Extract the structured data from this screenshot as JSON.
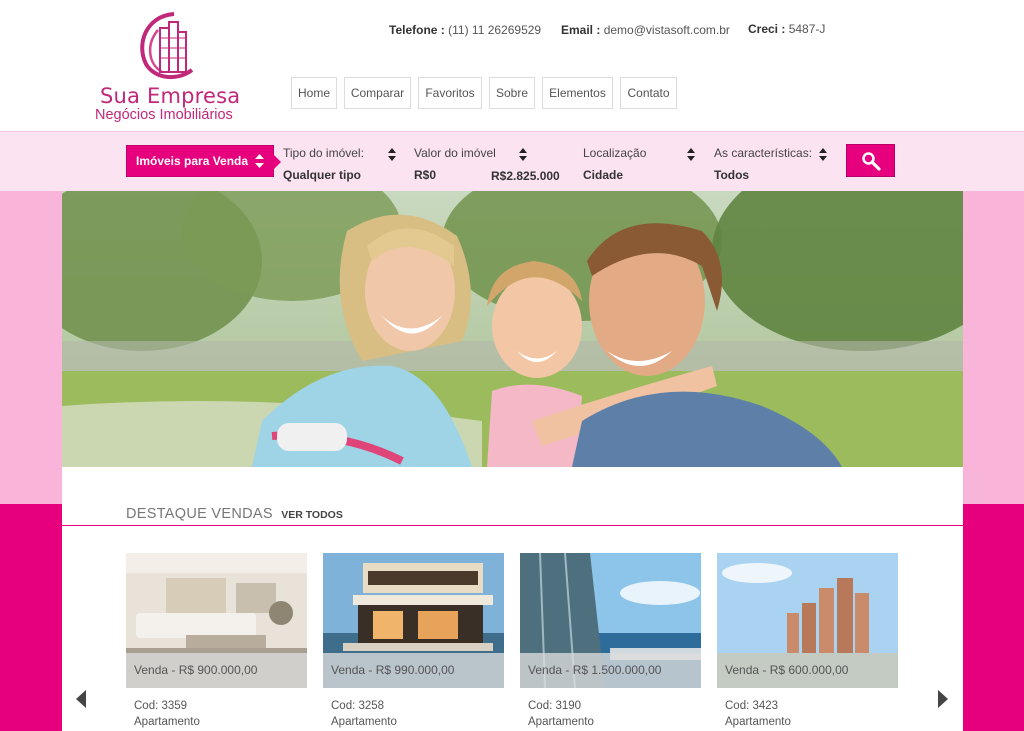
{
  "header": {
    "logo": {
      "name": "Sua Empresa",
      "tagline": "Negócios Imobiliários"
    },
    "contact": {
      "phone_label": "Telefone :",
      "phone": "(11) 11 26269529",
      "email_label": "Email :",
      "email": "demo@vistasoft.com.br",
      "creci_label": "Creci :",
      "creci": "5487-J"
    },
    "nav": [
      "Home",
      "Comparar",
      "Favoritos",
      "Sobre",
      "Elementos",
      "Contato"
    ]
  },
  "search": {
    "listing_type": "Imóveis para Venda",
    "property_type": {
      "label": "Tipo do imóvel:",
      "value": "Qualquer tipo"
    },
    "price": {
      "label": "Valor do imóvel",
      "min": "R$0",
      "max": "R$2.825.000"
    },
    "location": {
      "label": "Localização",
      "value": "Cidade"
    },
    "features": {
      "label": "As características:",
      "value": "Todos"
    }
  },
  "featured": {
    "title": "DESTAQUE VENDAS",
    "see_all": "VER TODOS",
    "cards": [
      {
        "price": "Venda - R$ 900.000,00",
        "code": "Cod: 3359",
        "kind": "Apartamento"
      },
      {
        "price": "Venda - R$ 990.000,00",
        "code": "Cod: 3258",
        "kind": "Apartamento"
      },
      {
        "price": "Venda - R$ 1.500.000,00",
        "code": "Cod: 3190",
        "kind": "Apartamento"
      },
      {
        "price": "Venda - R$ 600.000,00",
        "code": "Cod: 3423",
        "kind": "Apartamento"
      }
    ]
  },
  "colors": {
    "brand": "#e6007e",
    "brand_light": "#f9b4da",
    "search_bg": "#fbe3f1",
    "logo": "#c0287a"
  }
}
